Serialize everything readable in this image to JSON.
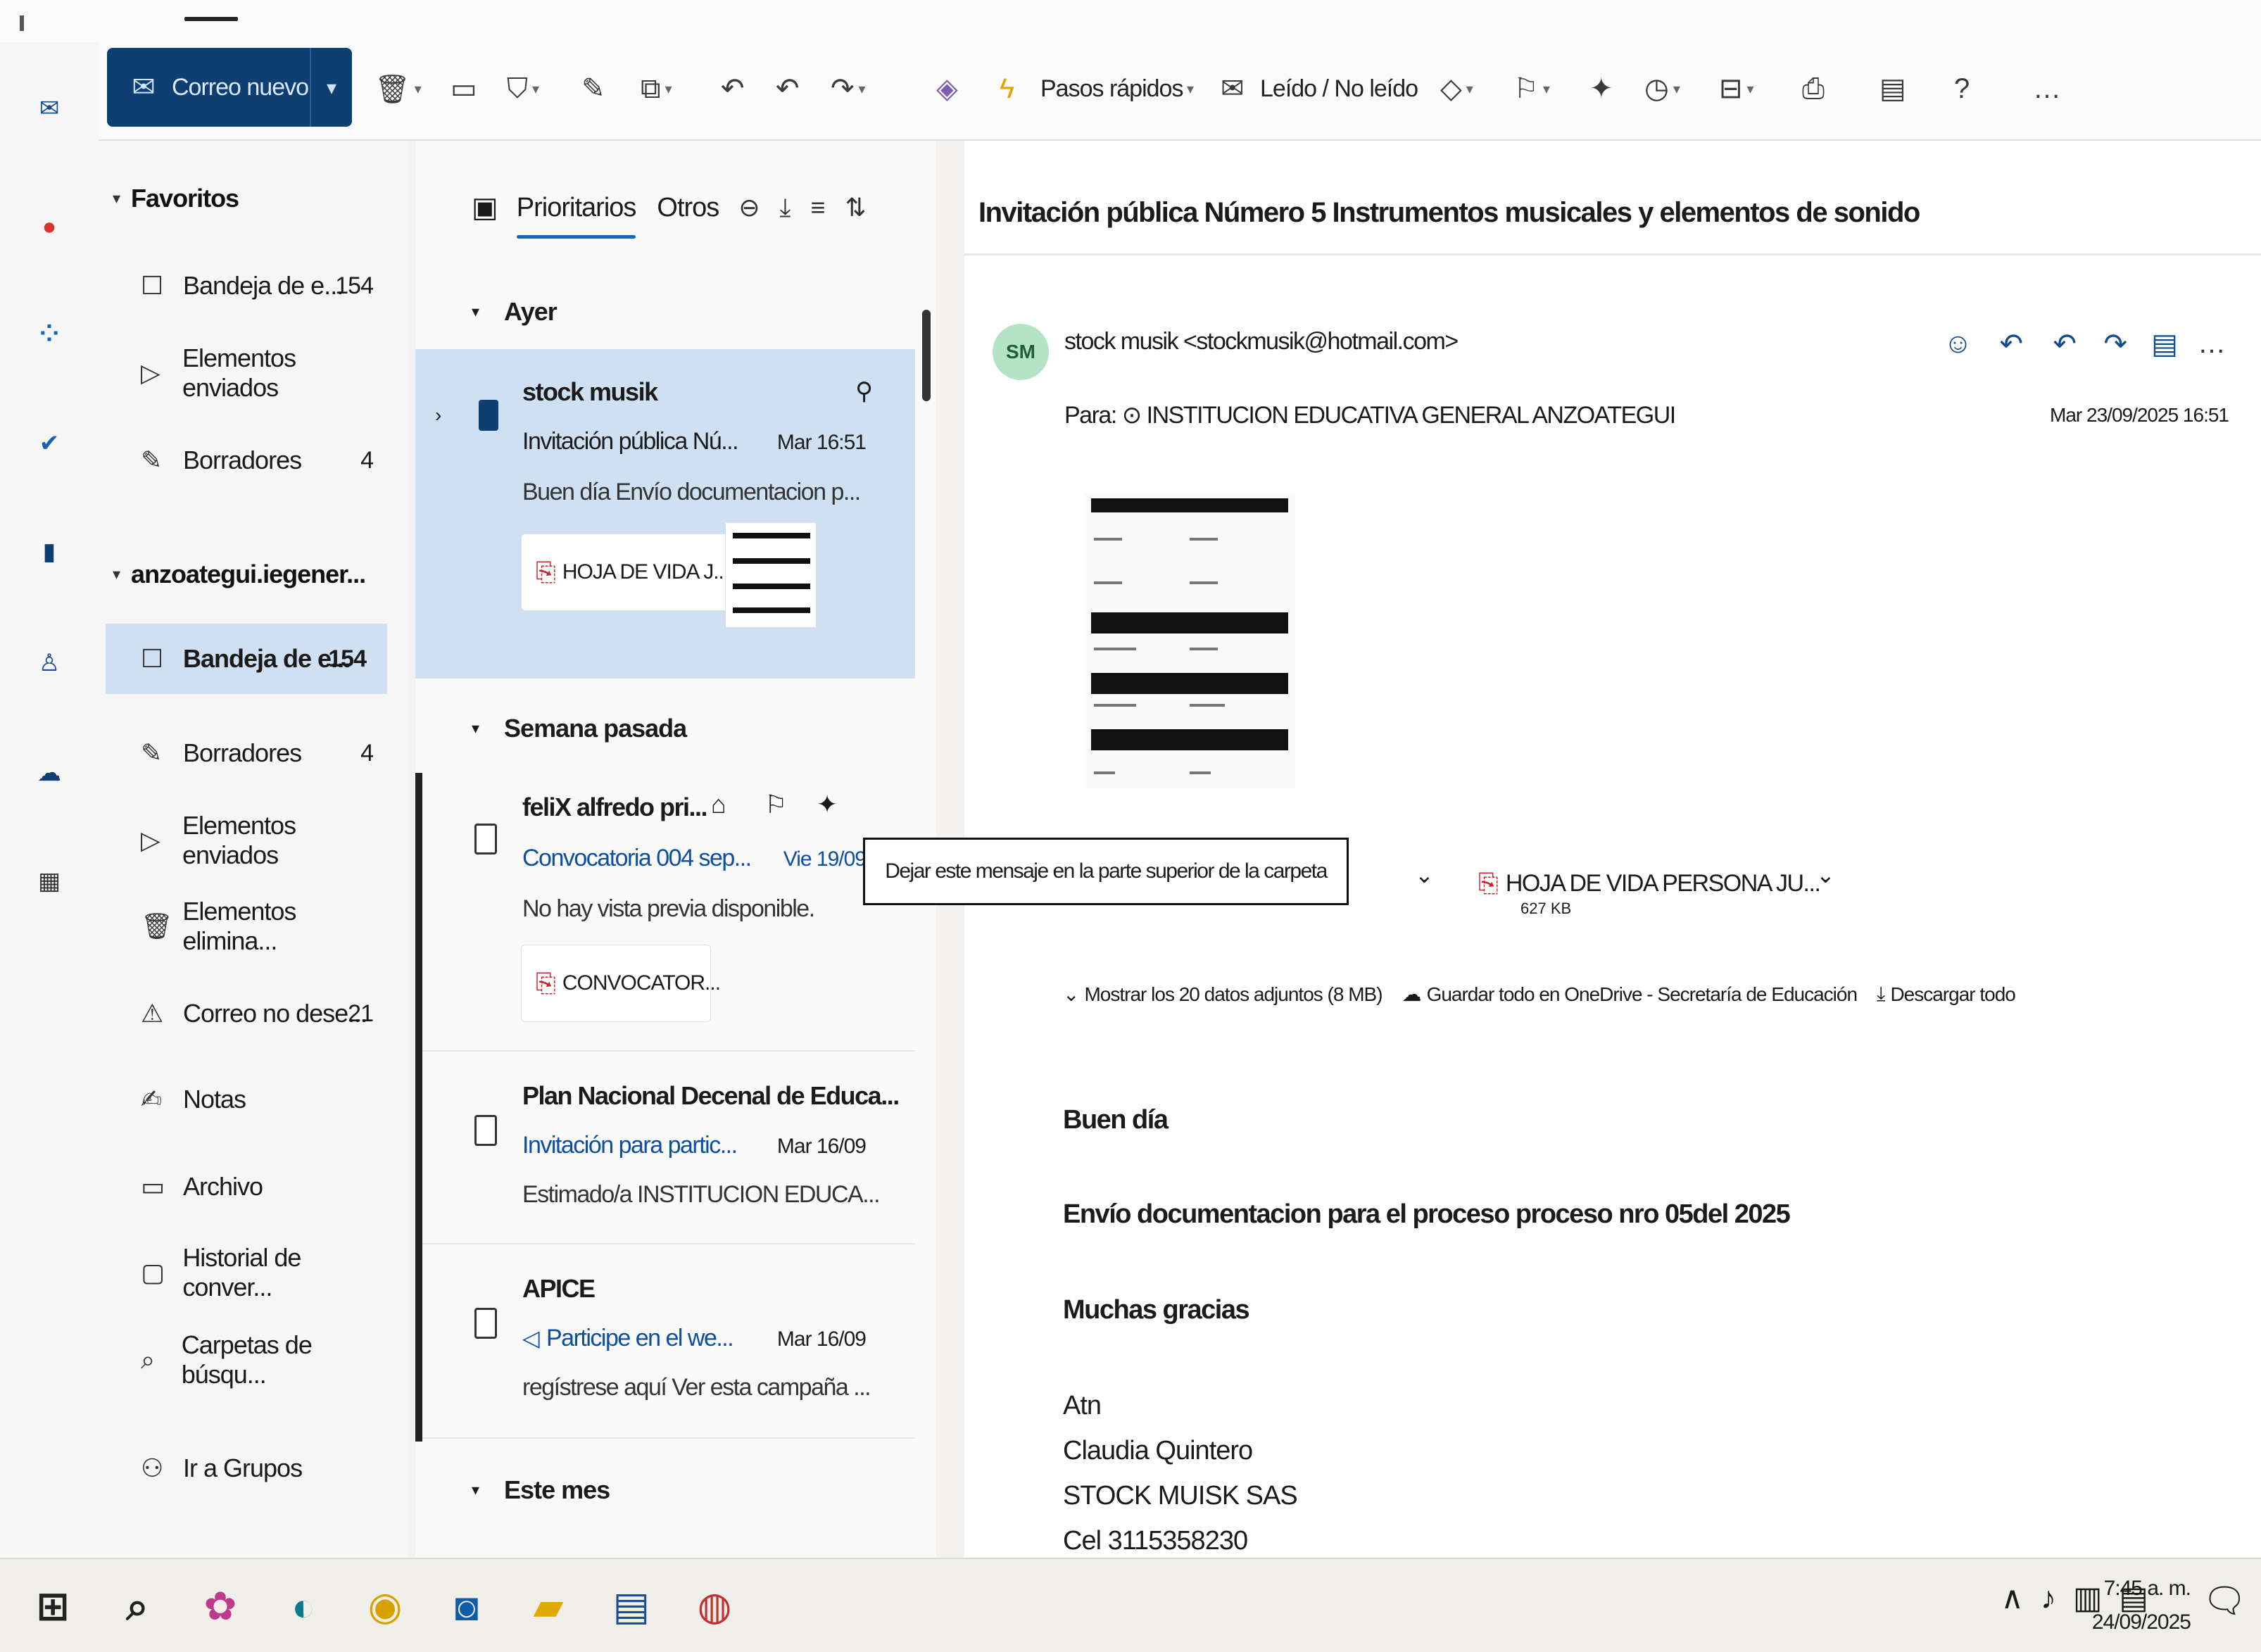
{
  "ribbon": {
    "new_mail": "Correo nuevo",
    "quick_steps": "Pasos rápidos",
    "read_unread": "Leído / No leído"
  },
  "folders": {
    "favorites_header": "Favoritos",
    "favorites": [
      {
        "label": "Bandeja de e...",
        "count": "154"
      },
      {
        "label": "Elementos enviados",
        "count": ""
      },
      {
        "label": "Borradores",
        "count": "4"
      }
    ],
    "account_header": "anzoategui.iegener...",
    "account": [
      {
        "label": "Bandeja de e...",
        "count": "154"
      },
      {
        "label": "Borradores",
        "count": "4"
      },
      {
        "label": "Elementos enviados",
        "count": ""
      },
      {
        "label": "Elementos elimina...",
        "count": ""
      },
      {
        "label": "Correo no dese...",
        "count": "21"
      },
      {
        "label": "Notas",
        "count": ""
      },
      {
        "label": "Archivo",
        "count": ""
      },
      {
        "label": "Historial de conver...",
        "count": ""
      },
      {
        "label": "Carpetas de búsqu...",
        "count": ""
      }
    ],
    "groups_link": "Ir a Grupos"
  },
  "list": {
    "tab_focused": "Prioritarios",
    "tab_other": "Otros",
    "group_yesterday": "Ayer",
    "group_last_week": "Semana pasada",
    "group_this_month": "Este mes",
    "messages": [
      {
        "from": "stock musik",
        "subject": "Invitación pública Nú...",
        "date": "Mar 16:51",
        "preview": "Buen día Envío documentacion p...",
        "attachment": "HOJA DE VIDA J..."
      },
      {
        "from": "feliX alfredo pri...",
        "subject": "Convocatoria 004 sep...",
        "date": "Vie 19/09",
        "preview": "No hay vista previa disponible.",
        "attachment": "CONVOCATOR..."
      },
      {
        "from": "Plan Nacional Decenal de Educa...",
        "subject": "Invitación para partic...",
        "date": "Mar 16/09",
        "preview": "Estimado/a INSTITUCION EDUCA..."
      },
      {
        "from": "APICE",
        "subject": "Participe en el we...",
        "date": "Mar 16/09",
        "preview": "regístrese aquí Ver esta campaña ..."
      }
    ]
  },
  "reading": {
    "subject": "Invitación pública Número 5 Instrumentos musicales y elementos de sonido",
    "avatar_initials": "SM",
    "sender": "stock musik <stockmusik@hotmail.com>",
    "to_label": "Para:",
    "to": "INSTITUCION EDUCATIVA GENERAL ANZOATEGUI",
    "date": "Mar 23/09/2025 16:51",
    "attachment_name": "HOJA DE VIDA PERSONA JU...",
    "attachment_size": "627 KB",
    "show_attachments": "Mostrar los 20 datos adjuntos (8 MB)",
    "save_onedrive": "Guardar todo en OneDrive - Secretaría de Educación",
    "download_all": "Descargar todo",
    "body": {
      "greeting": "Buen día",
      "line1": "Envío documentacion para el proceso  proceso nro 05del 2025",
      "thanks": "Muchas gracias",
      "atn": "Atn",
      "name": "Claudia Quintero",
      "company": "STOCK MUISK SAS",
      "phone": "Cel 3115358230"
    }
  },
  "tooltip": "Dejar este mensaje en la parte superior de la carpeta",
  "taskbar": {
    "time": "7:45 a. m.",
    "date": "24/09/2025"
  },
  "colors": {
    "accent": "#0f3e73",
    "selection": "#cfe0f3",
    "link_blue": "#0b4ea2",
    "avatar_bg": "#b5e3c5",
    "pdf_red": "#c4262e"
  }
}
